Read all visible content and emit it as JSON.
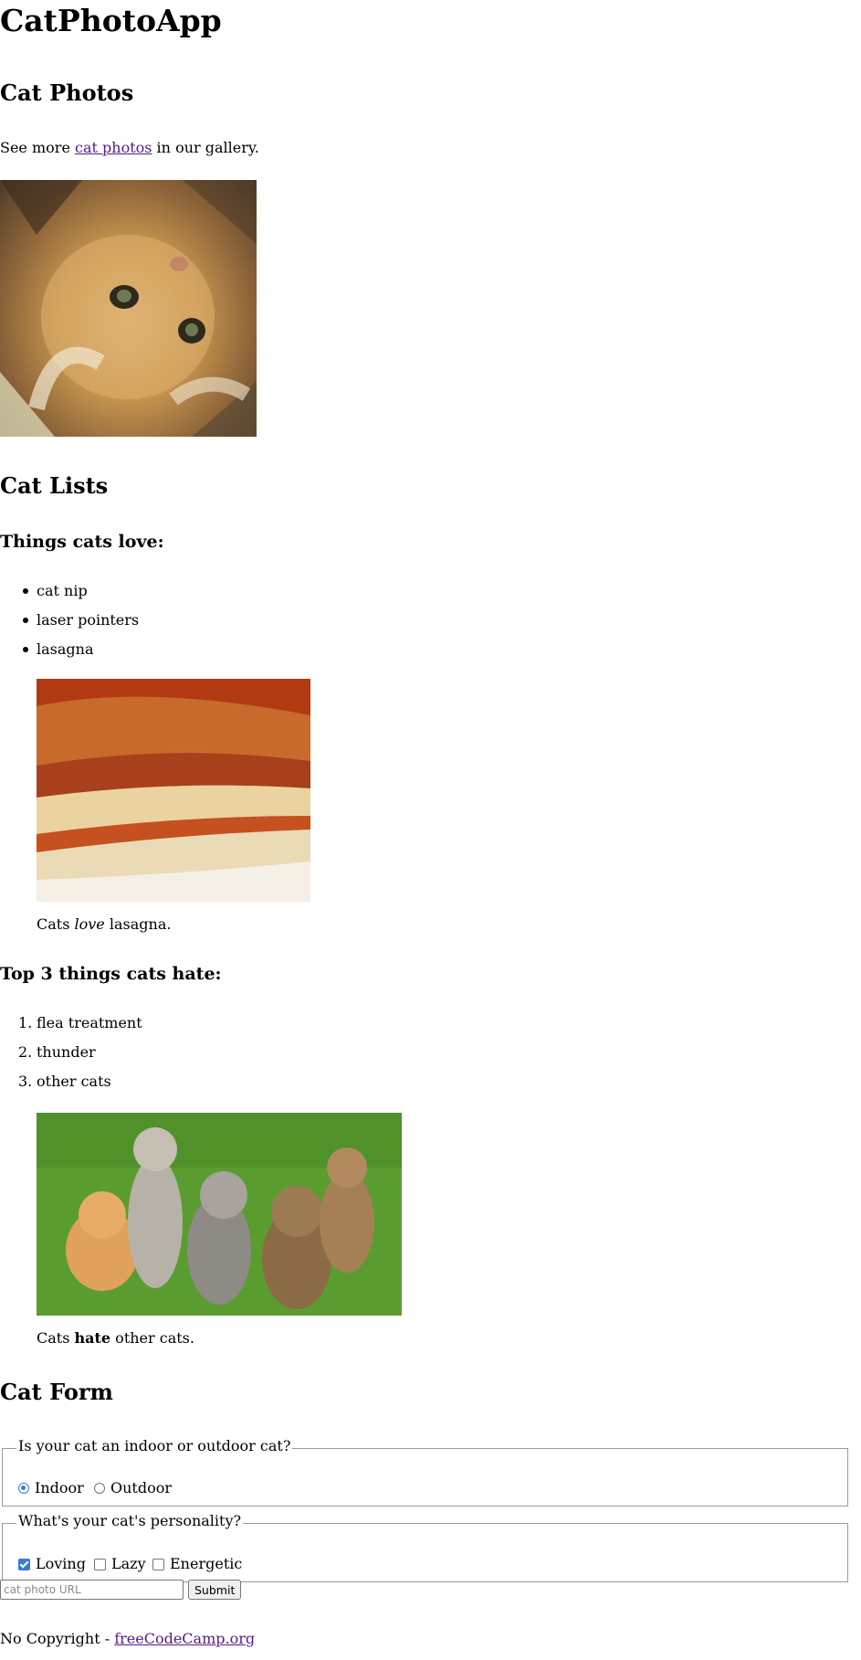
{
  "header": {
    "title": "CatPhotoApp"
  },
  "photos_section": {
    "heading": "Cat Photos",
    "gallery_text_before": "See more ",
    "gallery_link": "cat photos",
    "gallery_text_after": " in our gallery."
  },
  "lists_section": {
    "heading": "Cat Lists",
    "love_heading": "Things cats love:",
    "love_items": [
      "cat nip",
      "laser pointers",
      "lasagna"
    ],
    "love_caption_before": "Cats ",
    "love_caption_em": "love",
    "love_caption_after": " lasagna.",
    "hate_heading": "Top 3 things cats hate:",
    "hate_items": [
      "flea treatment",
      "thunder",
      "other cats"
    ],
    "hate_numbers": [
      "1.",
      "2.",
      "3."
    ],
    "hate_caption_before": "Cats ",
    "hate_caption_strong": "hate",
    "hate_caption_after": " other cats."
  },
  "form_section": {
    "heading": "Cat Form",
    "location_legend": "Is your cat an indoor or outdoor cat?",
    "location_options": [
      {
        "label": "Indoor",
        "selected": true
      },
      {
        "label": "Outdoor",
        "selected": false
      }
    ],
    "personality_legend": "What's your cat's personality?",
    "personality_options": [
      {
        "label": "Loving",
        "checked": true
      },
      {
        "label": "Lazy",
        "checked": false
      },
      {
        "label": "Energetic",
        "checked": false
      }
    ],
    "url_placeholder": "cat photo URL",
    "url_value": "",
    "submit_label": "Submit"
  },
  "footer": {
    "copyright_text": "No Copyright - ",
    "link_text": "freeCodeCamp.org"
  },
  "colors": {
    "link": "#551a8b",
    "control_accent": "#3b7bd4",
    "fieldset_border": "#9a9a9a"
  }
}
